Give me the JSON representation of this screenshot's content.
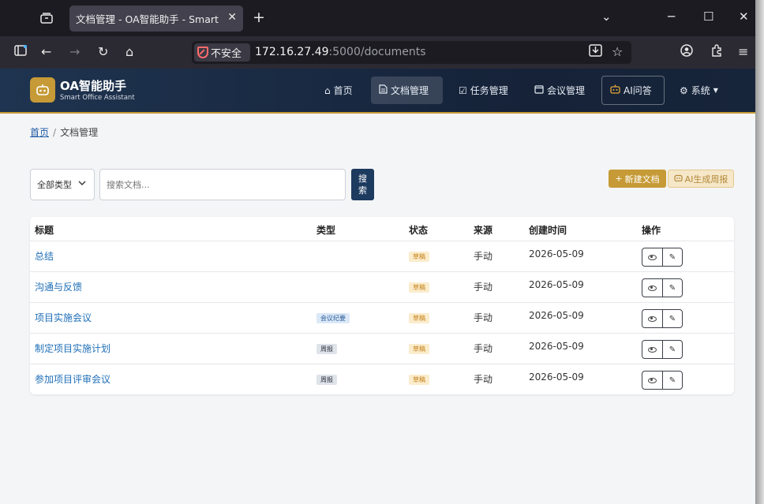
{
  "browser": {
    "tab_title": "文档管理 - OA智能助手 - Smart Office Assistant",
    "insecure_label": "不安全",
    "url_host": "172.16.27.49",
    "url_rest": ":5000/documents"
  },
  "brand": {
    "name": "OA智能助手",
    "subtitle": "Smart Office Assistant"
  },
  "nav": {
    "home": "首页",
    "documents": "文档管理",
    "tasks": "任务管理",
    "meetings": "会议管理",
    "ai": "AI问答",
    "system": "系统"
  },
  "breadcrumb": {
    "home": "首页",
    "current": "文档管理"
  },
  "filters": {
    "type_selected": "全部类型",
    "search_placeholder": "搜索文档...",
    "search_button": "搜索"
  },
  "actions": {
    "new_doc": "新建文档",
    "ai_report": "AI生成周报"
  },
  "table": {
    "headers": [
      "标题",
      "类型",
      "状态",
      "来源",
      "创建时间",
      "操作"
    ],
    "rows": [
      {
        "title": "总结",
        "type": "",
        "status": "草稿",
        "source": "手动",
        "created": "2026-05-09"
      },
      {
        "title": "沟通与反馈",
        "type": "",
        "status": "草稿",
        "source": "手动",
        "created": "2026-05-09"
      },
      {
        "title": "项目实施会议",
        "type": "会议纪要",
        "status": "草稿",
        "source": "手动",
        "created": "2026-05-09"
      },
      {
        "title": "制定项目实施计划",
        "type": "周报",
        "status": "草稿",
        "source": "手动",
        "created": "2026-05-09"
      },
      {
        "title": "参加项目评审会议",
        "type": "周报",
        "status": "草稿",
        "source": "手动",
        "created": "2026-05-09"
      }
    ]
  }
}
